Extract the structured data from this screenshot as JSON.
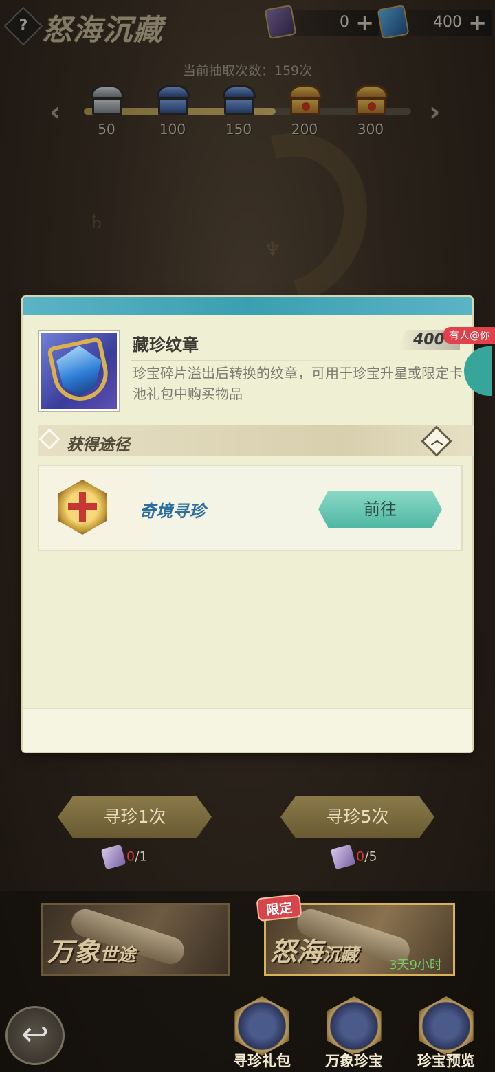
{
  "header": {
    "title": "怒海沉藏",
    "help_label": "?",
    "currencies": [
      {
        "icon": "scroll-ticket-icon",
        "value": "0",
        "plus": "+"
      },
      {
        "icon": "crest-gem-icon",
        "value": "400",
        "plus": "+"
      }
    ]
  },
  "progress": {
    "draw_count_text": "当前抽取次数：159次",
    "current": 159,
    "max": 300,
    "milestones": [
      {
        "label": "50",
        "chest": "silver"
      },
      {
        "label": "100",
        "chest": "blue"
      },
      {
        "label": "150",
        "chest": "blue"
      },
      {
        "label": "200",
        "chest": "gold"
      },
      {
        "label": "300",
        "chest": "gold"
      }
    ],
    "prev_arrow": "‹",
    "next_arrow": "›"
  },
  "dialog": {
    "item_name": "藏珍纹章",
    "item_count": "400",
    "item_desc": "珍宝碎片溢出后转换的纹章，可用于珍宝升星或限定卡池礼包中购买物品",
    "mention_badge": "有人@你",
    "section_title": "获得途径",
    "collapse_symbol": "︿",
    "sources": [
      {
        "name": "奇境寻珍",
        "button": "前往"
      }
    ]
  },
  "draw_buttons": [
    {
      "label": "寻珍1次",
      "have": "0",
      "need": "/1"
    },
    {
      "label": "寻珍5次",
      "have": "0",
      "need": "/5"
    }
  ],
  "pools": [
    {
      "name_main": "万象",
      "name_sub": "世途"
    },
    {
      "name_main": "怒海",
      "name_sub": "沉藏",
      "tag": "限定",
      "timer": "3天9小时"
    }
  ],
  "bottom_nav": {
    "back_symbol": "↩",
    "items": [
      {
        "label": "寻珍礼包"
      },
      {
        "label": "万象珍宝"
      },
      {
        "label": "珍宝预览"
      }
    ]
  }
}
